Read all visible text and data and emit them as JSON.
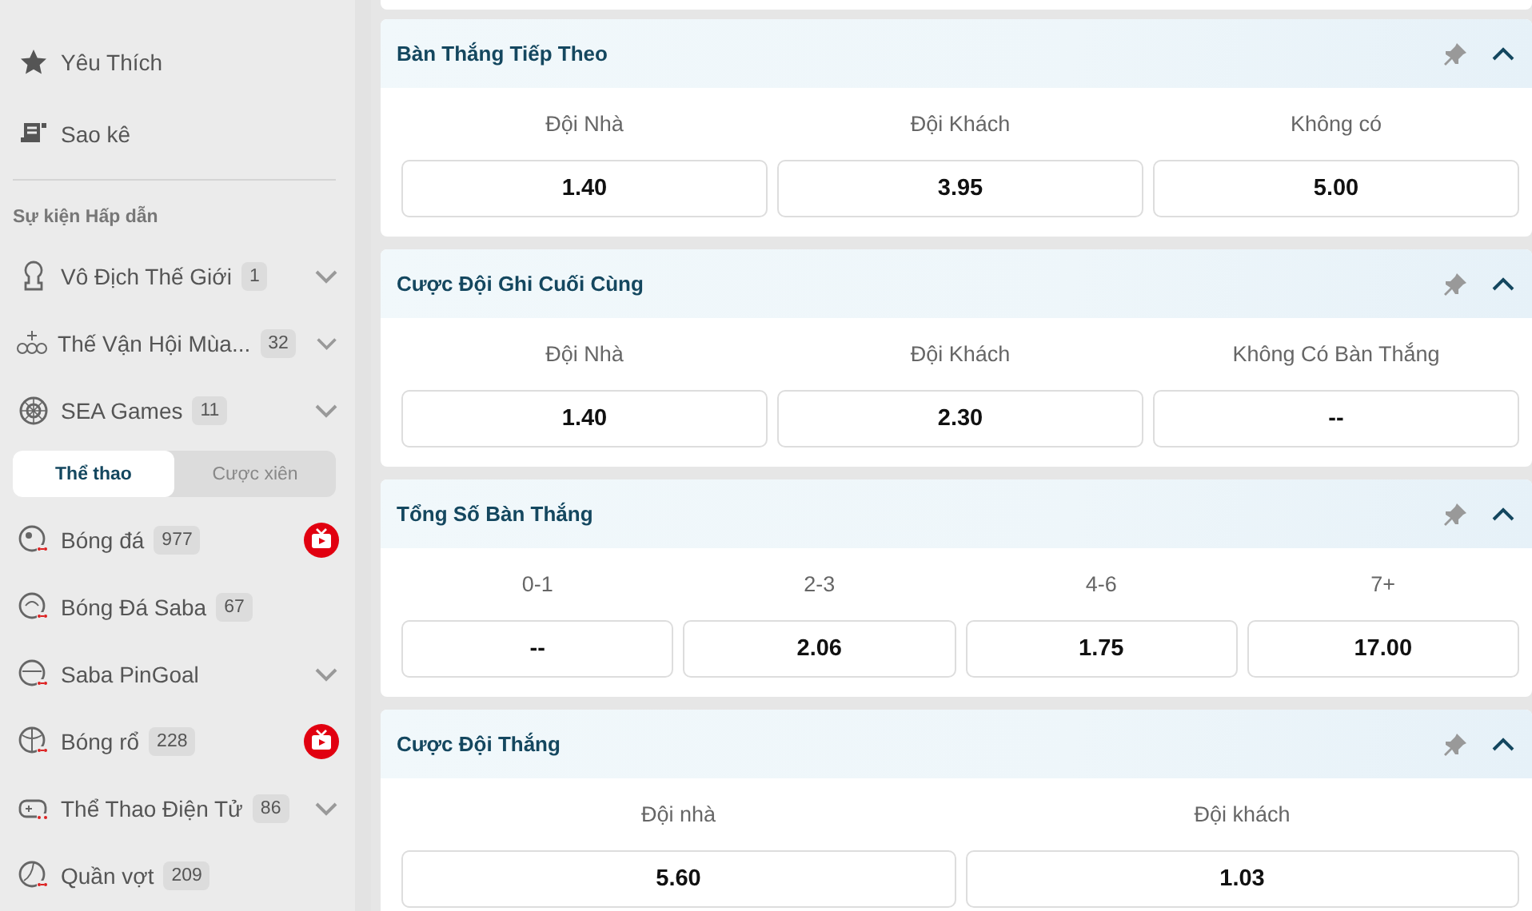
{
  "sidebar": {
    "links": [
      {
        "label": "Yêu Thích"
      },
      {
        "label": "Sao kê"
      }
    ],
    "section_title": "Sự kiện Hấp dẫn",
    "events": [
      {
        "label": "Vô Địch Thế Giới",
        "count": "1",
        "expandable": true
      },
      {
        "label": "Thế Vận Hội Mùa...",
        "count": "32",
        "expandable": true
      },
      {
        "label": "SEA Games",
        "count": "11",
        "expandable": true
      }
    ],
    "tabs": [
      {
        "label": "Thể thao",
        "selected": true
      },
      {
        "label": "Cược xiên",
        "selected": false
      }
    ],
    "sports": [
      {
        "label": "Bóng đá",
        "count": "977",
        "live": true,
        "expandable": false
      },
      {
        "label": "Bóng Đá Saba",
        "count": "67",
        "live": false,
        "expandable": false
      },
      {
        "label": "Saba PinGoal",
        "live": false,
        "expandable": true
      },
      {
        "label": "Bóng rổ",
        "count": "228",
        "live": true,
        "expandable": false
      },
      {
        "label": "Thể Thao Điện Tử",
        "count": "86",
        "live": false,
        "expandable": true
      },
      {
        "label": "Quần vợt",
        "count": "209",
        "live": false,
        "expandable": false
      }
    ]
  },
  "markets": [
    {
      "title": "Bàn Thắng Tiếp Theo",
      "expanded": true,
      "options": [
        {
          "label": "Đội Nhà",
          "odds": "1.40"
        },
        {
          "label": "Đội Khách",
          "odds": "3.95"
        },
        {
          "label": "Không có",
          "odds": "5.00"
        }
      ]
    },
    {
      "title": "Cược Đội Ghi Cuối Cùng",
      "expanded": true,
      "options": [
        {
          "label": "Đội Nhà",
          "odds": "1.40"
        },
        {
          "label": "Đội Khách",
          "odds": "2.30"
        },
        {
          "label": "Không Có Bàn Thắng",
          "odds": "--"
        }
      ]
    },
    {
      "title": "Tổng Số Bàn Thắng",
      "expanded": true,
      "options": [
        {
          "label": "0-1",
          "odds": "--"
        },
        {
          "label": "2-3",
          "odds": "2.06"
        },
        {
          "label": "4-6",
          "odds": "1.75"
        },
        {
          "label": "7+",
          "odds": "17.00"
        }
      ]
    },
    {
      "title": "Cược Đội Thắng",
      "expanded": true,
      "options": [
        {
          "label": "Đội nhà",
          "odds": "5.60"
        },
        {
          "label": "Đội khách",
          "odds": "1.03"
        }
      ]
    }
  ]
}
